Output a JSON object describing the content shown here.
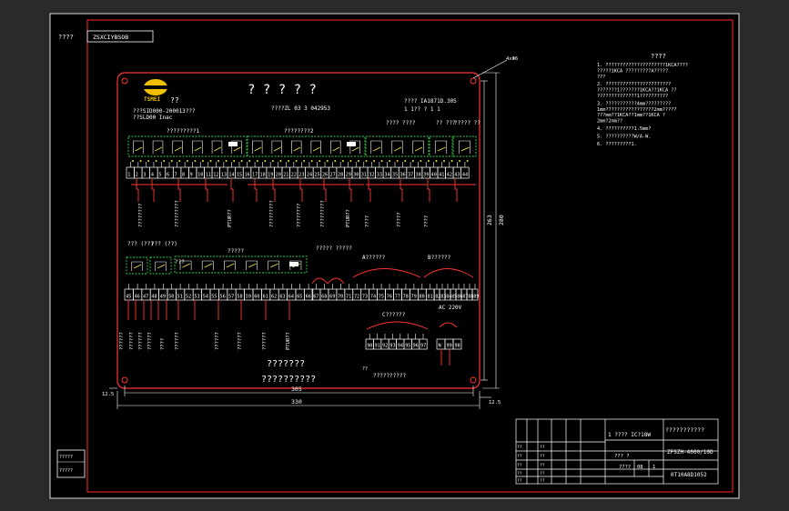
{
  "colors": {
    "background": "#000000",
    "frame": "#e0e0e0",
    "border_red": "#ff2a2a",
    "board_red": "#ff3333",
    "relay_green": "#39d04a",
    "contact_yellow": "#f4e04a",
    "text_white": "#ffffff",
    "logo_yellow": "#f0c000"
  },
  "top_left": {
    "label": "????",
    "drawing_code": "ZSXCIYBSOB"
  },
  "header": {
    "logo_text": "TSMEI",
    "logo_caption": "??",
    "title": "? ? ? ? ?",
    "line1": "???SID000-200013???",
    "line2": "??SLD00 Inac",
    "rated": "????ZL 03 3 042953",
    "right_line1": "???? IA1871D.305",
    "right_line2": "1 1?? ?    1     1"
  },
  "row1": {
    "group_labels": [
      "?????????1",
      "????????2",
      "????\n????",
      "??\n???",
      "?????\n??"
    ],
    "terminals": [
      "1",
      "2",
      "3",
      "4",
      "5",
      "6",
      "7",
      "8",
      "9",
      "10",
      "11",
      "12",
      "13",
      "14",
      "15",
      "16",
      "17",
      "18",
      "19",
      "20",
      "21",
      "22",
      "23",
      "24",
      "25",
      "26",
      "27",
      "28",
      "29",
      "30",
      "31",
      "32",
      "33",
      "34",
      "35",
      "36",
      "37",
      "38",
      "39",
      "40",
      "41",
      "42",
      "43",
      "44"
    ],
    "wire_labels": [
      "????????",
      "?????????",
      "PTUR??",
      "?????????",
      "????????",
      "?????????",
      "PTUR??",
      "????",
      "?????",
      "????"
    ]
  },
  "row2": {
    "group_labels": [
      "???\n(??)",
      "???\n(??)",
      "???",
      "?????"
    ],
    "terminals": [
      "45",
      "46",
      "47",
      "48",
      "49",
      "50",
      "51",
      "52",
      "53",
      "54",
      "55",
      "56",
      "57",
      "58",
      "59",
      "60",
      "61",
      "62",
      "63",
      "64",
      "65",
      "66"
    ],
    "wire_labels": [
      "??????",
      "??????",
      "??????",
      "??????",
      "????",
      "??????",
      "??????",
      "??????",
      "??????",
      "PTUR??"
    ]
  },
  "section_a": {
    "label": "A??????",
    "group": "?????\n?????",
    "terminals": [
      "67",
      "68",
      "69",
      "70",
      "71",
      "72",
      "73",
      "74",
      "75",
      "76",
      "77",
      "78",
      "79",
      "80",
      "81"
    ]
  },
  "section_b": {
    "label": "B??????",
    "terminals": [
      "82",
      "83",
      "84",
      "85",
      "86",
      "87",
      "88",
      "89"
    ]
  },
  "section_c": {
    "label": "C??????",
    "terminals": [
      "90",
      "91",
      "92",
      "93",
      "94",
      "95",
      "96",
      "97"
    ],
    "supply_label": "AC 220V",
    "supply_terms": [
      "N",
      "99",
      "98"
    ],
    "note": "??????????"
  },
  "bottom_texts": {
    "line1": "???????",
    "line2": "??????????",
    "small": "??"
  },
  "dimensions": {
    "width_inner": "305",
    "width_outer": "330",
    "height_inner": "263",
    "height_outer": "280",
    "offset_left": "12.5",
    "offset_bottom": "12.5",
    "corner_note": "4xΦ6"
  },
  "notes": {
    "title": "????",
    "items": [
      "1. ?????????????????????1KCA????\n   ?????1KCA ?????????A?????\n   ???",
      "2. ???????????????????????\n   ???????1???????1KCA??1KCA ??\n   ??????????????1??????????",
      "3. ???????????4mm?????????\n   1mm?????????????????2mm?????\n   ???mm??1KCA??1mm??1KCA ?\n   2mm?2mm??",
      "4. ??????????1.5mm?",
      "5. ??????????W/A-W.",
      "6. ?????????1."
    ]
  },
  "title_block": {
    "company": "???????????",
    "project": "1 ???? IC?18W",
    "drawing_no": "ZFSZH-4000/10D",
    "code": "0T10A8D1052",
    "scale": "??? ?",
    "sheet_cells": [
      "????",
      "08",
      "1"
    ],
    "row_labels": [
      "??",
      "??",
      "??",
      "??",
      "??",
      "??"
    ]
  },
  "left_stamp": {
    "line1": "?????",
    "line2": "?????"
  }
}
